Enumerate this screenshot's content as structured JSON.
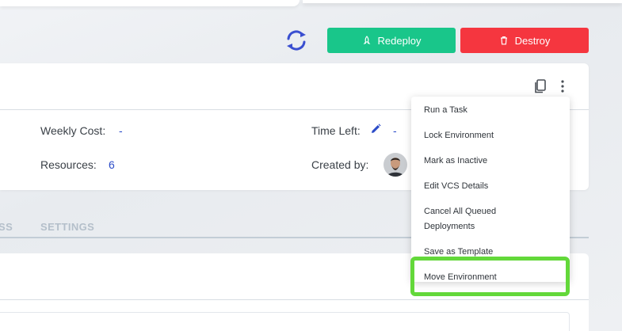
{
  "header": {
    "redeploy_label": "Redeploy",
    "destroy_label": "Destroy",
    "refresh_icon": "refresh-icon",
    "colors": {
      "redeploy": "#19c68a",
      "destroy": "#f5363f",
      "accent": "#2c4cc8"
    }
  },
  "info": {
    "weekly_cost_label": "Weekly Cost:",
    "weekly_cost_value": "-",
    "resources_label": "Resources:",
    "resources_value": "6",
    "time_left_label": "Time Left:",
    "time_left_value": "-",
    "created_by_label": "Created by:"
  },
  "tabs": [
    {
      "label": "SS"
    },
    {
      "label": "SETTINGS"
    }
  ],
  "menu": {
    "items": [
      {
        "label": "Run a Task"
      },
      {
        "label": "Lock Environment"
      },
      {
        "label": "Mark as Inactive"
      },
      {
        "label": "Edit VCS Details"
      },
      {
        "label": "Cancel All Queued"
      },
      {
        "label": "Deployments"
      },
      {
        "label": "Save as Template"
      },
      {
        "label": "Move Environment"
      }
    ],
    "highlight_color": "#63d83a"
  }
}
